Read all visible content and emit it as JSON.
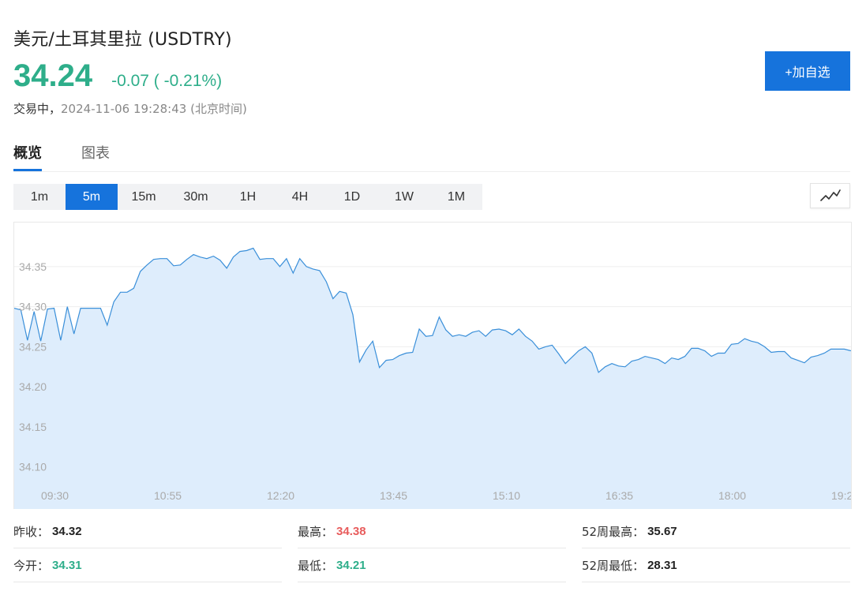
{
  "header": {
    "title": "美元/土耳其里拉 (USDTRY)",
    "price": "34.24",
    "change": "-0.07 ( -0.21%)",
    "status": "交易中，",
    "timestamp": "2024-11-06 19:28:43 (北京时间)",
    "add_button": "+加自选"
  },
  "tabs": [
    {
      "label": "概览",
      "active": true
    },
    {
      "label": "图表",
      "active": false
    }
  ],
  "periods": [
    {
      "label": "1m",
      "active": false
    },
    {
      "label": "5m",
      "active": true
    },
    {
      "label": "15m",
      "active": false
    },
    {
      "label": "30m",
      "active": false
    },
    {
      "label": "1H",
      "active": false
    },
    {
      "label": "4H",
      "active": false
    },
    {
      "label": "1D",
      "active": false
    },
    {
      "label": "1W",
      "active": false
    },
    {
      "label": "1M",
      "active": false
    }
  ],
  "chart_type_icon": "line-chart-icon",
  "colors": {
    "up": "#2eae8a",
    "down": "#e85c5c",
    "accent": "#1673dc",
    "line": "#3a8fd9",
    "area": "#deedfc"
  },
  "chart_data": {
    "type": "area",
    "title": "",
    "xlabel": "",
    "ylabel": "",
    "ylim": [
      34.08,
      34.405
    ],
    "yticks": [
      "34.35",
      "34.30",
      "34.25",
      "34.20",
      "34.15",
      "34.10"
    ],
    "ytick_values": [
      34.35,
      34.3,
      34.25,
      34.2,
      34.15,
      34.1
    ],
    "xticks": [
      "09:30",
      "10:55",
      "12:20",
      "13:45",
      "15:10",
      "16:35",
      "18:00",
      "19:2"
    ],
    "series": [
      {
        "x_step_minutes": 5,
        "x_start": "09:00",
        "values": [
          34.298,
          34.296,
          34.258,
          34.294,
          34.257,
          34.297,
          34.298,
          34.258,
          34.3,
          34.266,
          34.298,
          34.298,
          34.298,
          34.298,
          34.277,
          34.306,
          34.318,
          34.318,
          34.323,
          34.344,
          34.352,
          34.359,
          34.36,
          34.36,
          34.351,
          34.352,
          34.359,
          34.365,
          34.362,
          34.36,
          34.363,
          34.358,
          34.348,
          34.362,
          34.369,
          34.37,
          34.373,
          34.359,
          34.36,
          34.36,
          34.35,
          34.36,
          34.342,
          34.36,
          34.35,
          34.347,
          34.345,
          34.331,
          34.31,
          34.319,
          34.317,
          34.29,
          34.231,
          34.246,
          34.257,
          34.224,
          34.233,
          34.234,
          34.239,
          34.242,
          34.243,
          34.272,
          34.263,
          34.264,
          34.287,
          34.271,
          34.263,
          34.265,
          34.263,
          34.268,
          34.27,
          34.263,
          34.271,
          34.272,
          34.27,
          34.265,
          34.272,
          34.263,
          34.257,
          34.247,
          34.25,
          34.252,
          34.241,
          34.229,
          34.237,
          34.245,
          34.25,
          34.242,
          34.218,
          34.225,
          34.229,
          34.226,
          34.225,
          34.232,
          34.234,
          34.238,
          34.236,
          34.234,
          34.229,
          34.236,
          34.234,
          34.238,
          34.248,
          34.248,
          34.245,
          34.238,
          34.242,
          34.242,
          34.253,
          34.254,
          34.26,
          34.257,
          34.255,
          34.25,
          34.243,
          34.244,
          34.244,
          34.236,
          34.233,
          34.23,
          34.237,
          34.239,
          34.242,
          34.247,
          34.247,
          34.247,
          34.245
        ]
      }
    ],
    "grid": true
  },
  "stats": [
    {
      "label": "昨收：",
      "value": "34.32",
      "color": "#222222"
    },
    {
      "label": "最高：",
      "value": "34.38",
      "color": "#e85c5c"
    },
    {
      "label": "52周最高：",
      "value": "35.67",
      "color": "#222222"
    },
    {
      "label": "今开：",
      "value": "34.31",
      "color": "#2eae8a"
    },
    {
      "label": "最低：",
      "value": "34.21",
      "color": "#2eae8a"
    },
    {
      "label": "52周最低：",
      "value": "28.31",
      "color": "#222222"
    }
  ]
}
